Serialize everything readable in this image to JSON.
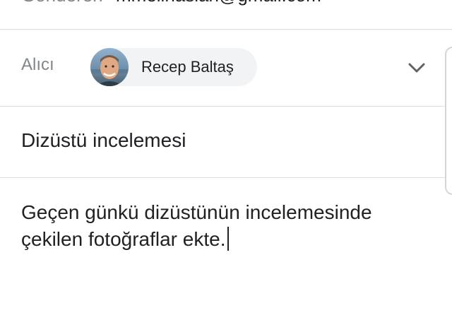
{
  "compose": {
    "from": {
      "label": "Gönderen",
      "value": "mmelihaslan@gmail.com"
    },
    "to": {
      "label": "Alıcı",
      "recipients": [
        {
          "name": "Recep Baltaş",
          "avatar_icon": "person-avatar"
        }
      ],
      "expand_icon": "chevron-down-icon"
    },
    "subject": "Dizüstü incelemesi",
    "body": {
      "lines": [
        "Geçen günkü dizüstünün incelemesinde",
        "çekilen fotoğraflar ekte."
      ]
    }
  },
  "colors": {
    "label": "#80868b",
    "text": "#202124",
    "chip_background": "#f1f3f4",
    "divider": "#dadce0"
  }
}
